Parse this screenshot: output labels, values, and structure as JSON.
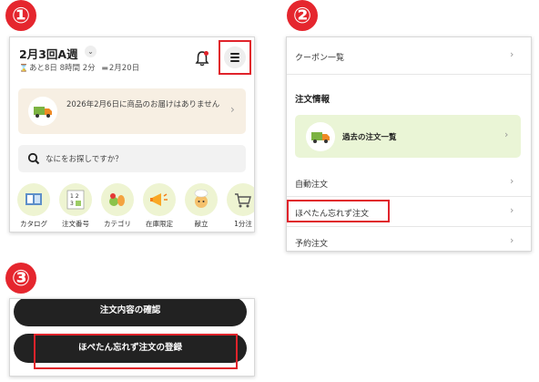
{
  "steps": [
    "①",
    "②",
    "③"
  ],
  "panel1": {
    "week_title": "2月3回A週",
    "week_chevron": "⌄",
    "deadline": "あと8日 8時間 2分",
    "delivery_date": "2月20日",
    "notice_text": "2026年2月6日に商品のお届けはありません",
    "search_placeholder": "なにをお探しですか？",
    "categories": [
      {
        "label": "カタログ"
      },
      {
        "label": "注文番号"
      },
      {
        "label": "カテゴリ"
      },
      {
        "label": "在庫限定"
      },
      {
        "label": "献立"
      },
      {
        "label": "1分注"
      }
    ],
    "colors": {
      "highlight": "#e0232b",
      "notice_bg": "#f7efe3",
      "category_bg": "#eef4d2",
      "truck": "#6aa84f"
    }
  },
  "panel2": {
    "coupon_list": "クーポン一覧",
    "section_heading": "注文情報",
    "past_orders": "過去の注文一覧",
    "auto_order": "自動注文",
    "forgotten_order": "ほぺたん忘れず注文",
    "reserved_order": "予約注文",
    "chevron": "›"
  },
  "panel3": {
    "confirm_button": "注文内容の確認",
    "register_button": "ほぺたん忘れず注文の登録"
  }
}
